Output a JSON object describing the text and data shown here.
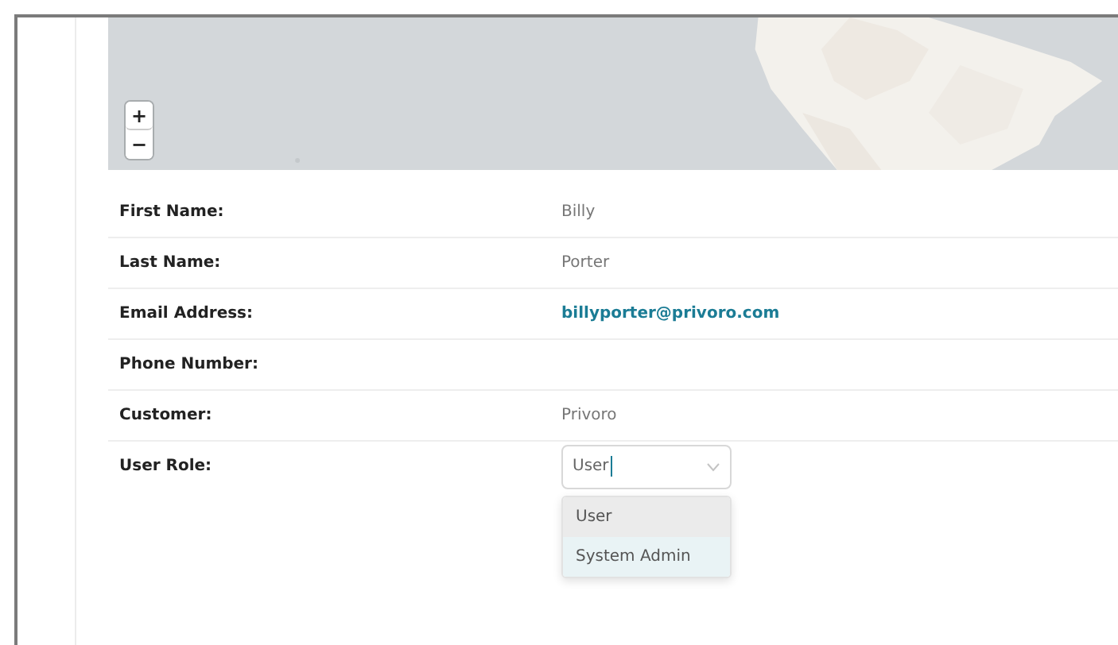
{
  "map": {
    "kind": "picture",
    "zoom_controls": [
      "+",
      "−"
    ]
  },
  "fields": [
    {
      "label": "First Name:",
      "value": "Billy",
      "kind": "text"
    },
    {
      "label": "Last Name:",
      "value": "Porter",
      "kind": "text"
    },
    {
      "label": "Email Address:",
      "value": "billyporter@privoro.com",
      "kind": "link"
    },
    {
      "label": "Phone Number:",
      "kind": "text"
    },
    {
      "label": "Customer:",
      "value": "Privoro",
      "kind": "text"
    },
    {
      "label": "User Role:",
      "value": "User",
      "kind": "select",
      "expanded": true,
      "options": [
        {
          "label": "User",
          "selected": true,
          "hovered": false
        },
        {
          "label": "System Admin",
          "selected": false,
          "hovered": true
        }
      ]
    }
  ]
}
